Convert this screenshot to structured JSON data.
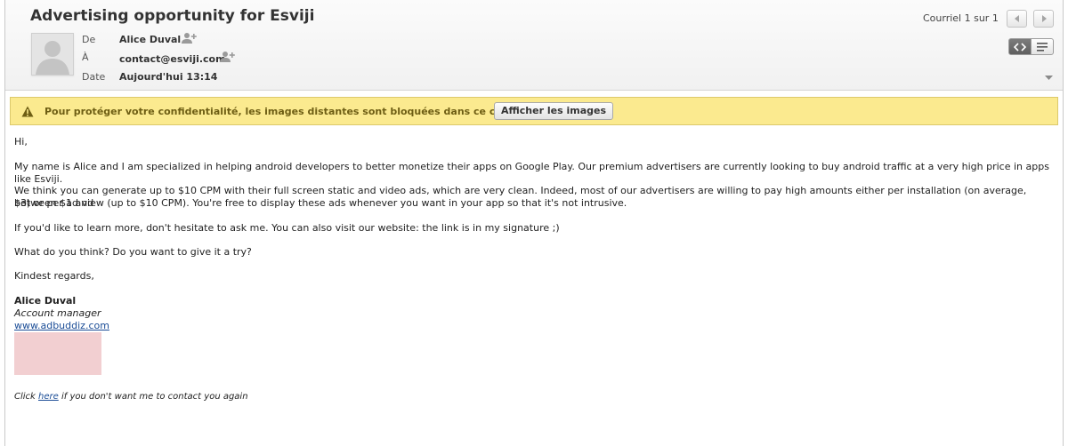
{
  "email": {
    "subject": "Advertising opportunity for Esviji",
    "fields": {
      "from_label": "De",
      "from_value": "Alice Duval",
      "to_label": "À",
      "to_value": "contact@esviji.com",
      "date_label": "Date",
      "date_value": "Aujourd'hui 13:14"
    },
    "counter": "Courriel 1 sur 1"
  },
  "warning": {
    "text": "Pour protéger votre confidentialité, les images distantes sont bloquées dans ce courriel.",
    "button_label": "Afficher les images"
  },
  "body": {
    "greeting": "Hi,",
    "p1": "My name is Alice and I am specialized in helping android developers to better monetize their apps on Google Play. Our premium advertisers are currently looking to buy android traffic at a very high price in apps like Esviji.",
    "p2a": "We think you can generate up to $10 CPM with their full screen static and video ads, which are very clean. Indeed, most of our advertisers are willing to pay high amounts either per installation (on average, between $1 and",
    "p2b": "$3) or per ad view (up to $10 CPM). You're free to display these ads whenever you want in your app so that it's not intrusive.",
    "p3": "If you'd like to learn more, don't hesitate to ask me. You can also visit our website: the link is in my signature ;)",
    "p4": "What do you think? Do you want to give it a try?",
    "closing": "Kindest regards,",
    "signature": {
      "name": "Alice Duval",
      "title": "Account manager",
      "website": "www.adbuddiz.com"
    },
    "footer": {
      "prefix": "Click ",
      "link": "here",
      "suffix": " if you don't want me to contact you again"
    }
  },
  "colors": {
    "warning_bg": "#fbea8f",
    "link": "#1a4c96",
    "signature_image": "#f2cfd1"
  },
  "icons": [
    "avatar-placeholder",
    "add-contact-icon",
    "warning-icon",
    "prev-arrow-icon",
    "next-arrow-icon",
    "raw-source-icon",
    "text-view-icon",
    "expand-arrow-icon"
  ]
}
